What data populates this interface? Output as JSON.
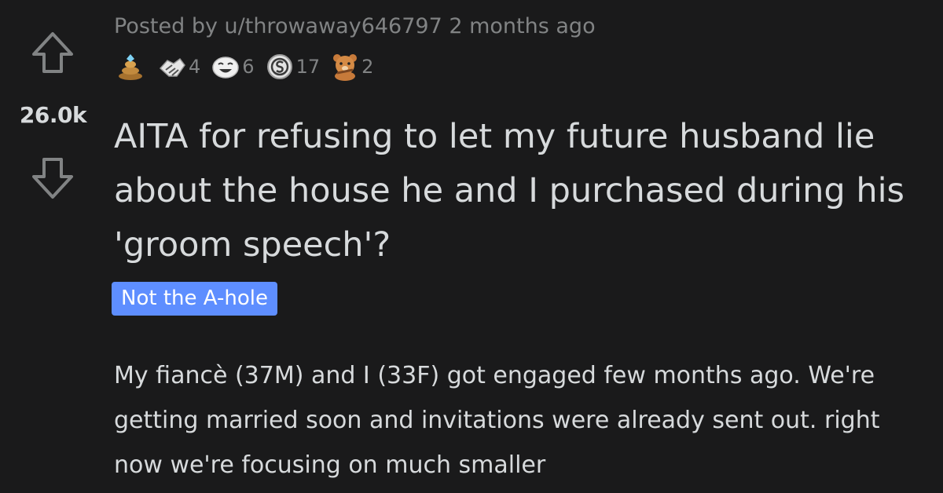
{
  "post": {
    "score": "26.0k",
    "meta": "Posted by u/throwaway646797 2 months ago",
    "awards": [
      {
        "icon": "poop-award-icon",
        "count": ""
      },
      {
        "icon": "handshake-award-icon",
        "count": "4"
      },
      {
        "icon": "laughing-face-award-icon",
        "count": "6"
      },
      {
        "icon": "silver-coin-award-icon",
        "count": "17"
      },
      {
        "icon": "bear-award-icon",
        "count": "2"
      }
    ],
    "title": "AITA for refusing to let my future husband lie about the house he and I purchased during his 'groom speech'?",
    "flair": "Not the A-hole",
    "body": "My fiancè (37M) and I (33F) got engaged few months ago. We're getting married soon and invitations were already sent out. right now we're focusing on much smaller"
  },
  "colors": {
    "background": "#1a1a1b",
    "text": "#d7dadc",
    "meta": "#818384",
    "flair": "#5e8eff"
  }
}
